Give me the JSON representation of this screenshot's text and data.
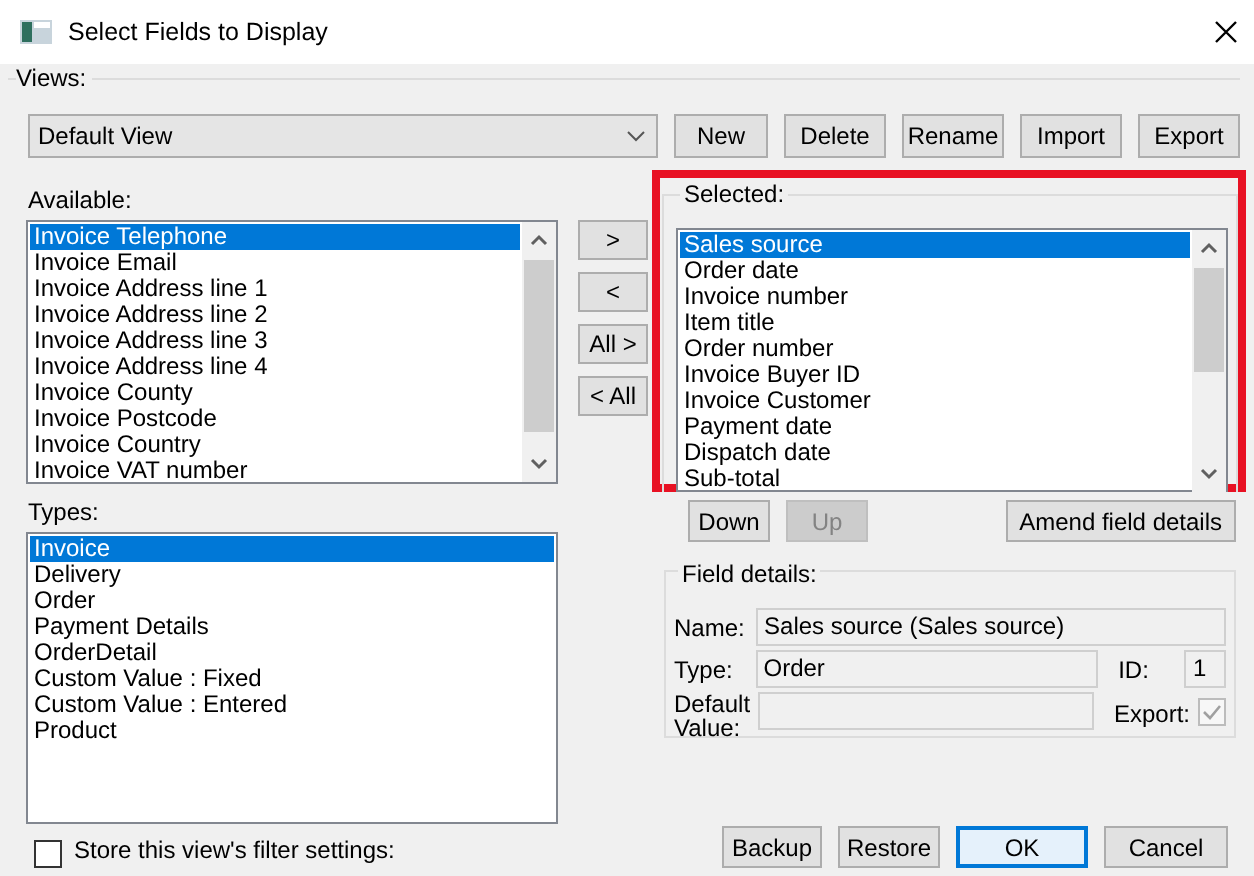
{
  "window": {
    "title": "Select Fields to Display"
  },
  "views": {
    "label": "Views:",
    "dropdown": {
      "value": "Default View"
    },
    "buttons": [
      "New",
      "Delete",
      "Rename",
      "Import",
      "Export"
    ]
  },
  "available": {
    "label": "Available:",
    "items": [
      {
        "label": "Invoice Telephone",
        "selected": true
      },
      {
        "label": "Invoice Email",
        "selected": false
      },
      {
        "label": "Invoice Address line 1",
        "selected": false
      },
      {
        "label": "Invoice Address line 2",
        "selected": false
      },
      {
        "label": "Invoice Address line 3",
        "selected": false
      },
      {
        "label": "Invoice Address line 4",
        "selected": false
      },
      {
        "label": "Invoice County",
        "selected": false
      },
      {
        "label": "Invoice Postcode",
        "selected": false
      },
      {
        "label": "Invoice Country",
        "selected": false
      },
      {
        "label": "Invoice VAT number",
        "selected": false
      }
    ]
  },
  "transfer_buttons": [
    ">",
    "<",
    "All >",
    "< All"
  ],
  "types": {
    "label": "Types:",
    "items": [
      {
        "label": "Invoice",
        "selected": true
      },
      {
        "label": "Delivery",
        "selected": false
      },
      {
        "label": "Order",
        "selected": false
      },
      {
        "label": "Payment Details",
        "selected": false
      },
      {
        "label": "OrderDetail",
        "selected": false
      },
      {
        "label": "Custom Value : Fixed",
        "selected": false
      },
      {
        "label": "Custom Value : Entered",
        "selected": false
      },
      {
        "label": "Product",
        "selected": false
      }
    ]
  },
  "store_filter": {
    "label": "Store this view's filter settings:",
    "checked": false
  },
  "selected": {
    "label": "Selected:",
    "highlighted": true,
    "items": [
      {
        "label": "Sales source",
        "selected": true
      },
      {
        "label": "Order date",
        "selected": false
      },
      {
        "label": "Invoice number",
        "selected": false
      },
      {
        "label": "Item title",
        "selected": false
      },
      {
        "label": "Order number",
        "selected": false
      },
      {
        "label": "Invoice Buyer ID",
        "selected": false
      },
      {
        "label": "Invoice Customer",
        "selected": false
      },
      {
        "label": "Payment date",
        "selected": false
      },
      {
        "label": "Dispatch date",
        "selected": false
      },
      {
        "label": "Sub-total",
        "selected": false
      }
    ]
  },
  "order_buttons": [
    {
      "label": "Down",
      "disabled": false
    },
    {
      "label": "Up",
      "disabled": true
    },
    {
      "label": "Amend field details",
      "disabled": false
    }
  ],
  "field_details": {
    "label": "Field details:",
    "name": {
      "label": "Name:",
      "value": "Sales source (Sales source)"
    },
    "type": {
      "label": "Type:",
      "value": "Order"
    },
    "id": {
      "label": "ID:",
      "value": "1"
    },
    "default_value": {
      "label": "Default Value:"
    },
    "export": {
      "label": "Export:",
      "checked": true,
      "disabled": true
    }
  },
  "buttons": [
    {
      "label": "Backup",
      "default": false
    },
    {
      "label": "Restore",
      "default": false
    },
    {
      "label": "OK",
      "default": true
    },
    {
      "label": "Cancel",
      "default": false
    }
  ]
}
